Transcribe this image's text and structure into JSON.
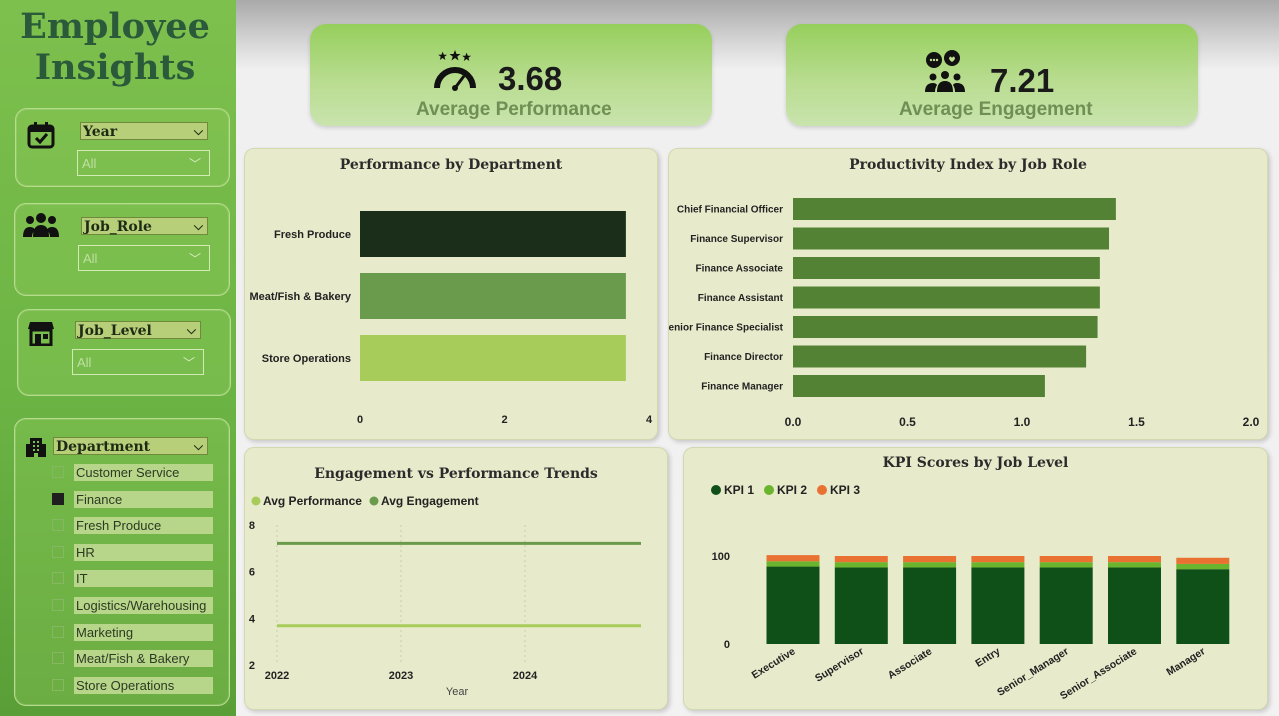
{
  "sidebar": {
    "title_line1": "Employee",
    "title_line2": "Insights",
    "slicers": {
      "year": {
        "label": "Year",
        "value": "All",
        "icon": "calendar-icon"
      },
      "job_role": {
        "label": "Job_Role",
        "value": "All",
        "icon": "people-group-icon"
      },
      "job_level": {
        "label": "Job_Level",
        "value": "All",
        "icon": "store-icon"
      }
    },
    "department": {
      "label": "Department",
      "icon": "building-icon",
      "items": [
        {
          "label": "Customer Service",
          "checked": false
        },
        {
          "label": "Finance",
          "checked": true
        },
        {
          "label": "Fresh Produce",
          "checked": false
        },
        {
          "label": "HR",
          "checked": false
        },
        {
          "label": "IT",
          "checked": false
        },
        {
          "label": "Logistics/Warehousing",
          "checked": false
        },
        {
          "label": "Marketing",
          "checked": false
        },
        {
          "label": "Meat/Fish & Bakery",
          "checked": false
        },
        {
          "label": "Store Operations",
          "checked": false
        }
      ]
    }
  },
  "kpis": {
    "performance": {
      "value": "3.68",
      "label": "Average Performance",
      "icon": "speedometer-stars-icon"
    },
    "engagement": {
      "value": "7.21",
      "label": "Average Engagement",
      "icon": "team-chat-icon"
    }
  },
  "charts": {
    "performance_by_department": {
      "title": "Performance by Department",
      "chart_data": {
        "type": "bar",
        "orientation": "horizontal",
        "categories": [
          "Fresh Produce",
          "Meat/Fish & Bakery",
          "Store Operations"
        ],
        "values": [
          3.68,
          3.68,
          3.68
        ],
        "colors": [
          "#1a2e1a",
          "#6a9a4c",
          "#a8cc5a"
        ],
        "xlim": [
          0,
          4
        ],
        "xticks": [
          "0",
          "2",
          "4"
        ]
      }
    },
    "productivity_by_role": {
      "title": "Productivity Index by Job Role",
      "chart_data": {
        "type": "bar",
        "orientation": "horizontal",
        "categories": [
          "Chief Financial Officer",
          "Finance Supervisor",
          "Finance Associate",
          "Finance Assistant",
          "Senior Finance Specialist",
          "Finance Director",
          "Finance Manager"
        ],
        "values": [
          1.41,
          1.38,
          1.34,
          1.34,
          1.33,
          1.28,
          1.1
        ],
        "color": "#548235",
        "xlim": [
          0,
          2.0
        ],
        "xticks": [
          "0.0",
          "0.5",
          "1.0",
          "1.5",
          "2.0"
        ]
      }
    },
    "engagement_vs_performance": {
      "title": "Engagement vs Performance Trends",
      "chart_data": {
        "type": "line",
        "x": [
          "2022",
          "2023",
          "2024"
        ],
        "xlabel": "Year",
        "series": [
          {
            "name": "Avg Performance",
            "values": [
              3.68,
              3.68,
              3.68
            ],
            "color": "#a8cc5a"
          },
          {
            "name": "Avg Engagement",
            "values": [
              7.21,
              7.21,
              7.21
            ],
            "color": "#6a9a4c"
          }
        ],
        "ylim": [
          2,
          8
        ],
        "yticks": [
          "2",
          "4",
          "6",
          "8"
        ]
      }
    },
    "kpi_by_level": {
      "title": "KPI Scores by Job Level",
      "chart_data": {
        "type": "bar",
        "stacked": true,
        "categories": [
          "Executive",
          "Supervisor",
          "Associate",
          "Entry",
          "Senior_Manager",
          "Senior_Associate",
          "Manager"
        ],
        "series": [
          {
            "name": "KPI 1",
            "values": [
              88,
              87,
              87,
              87,
              87,
              87,
              85
            ],
            "color": "#0f4f18"
          },
          {
            "name": "KPI 2",
            "values": [
              6,
              6,
              6,
              6,
              6,
              6,
              6
            ],
            "color": "#6ab42e"
          },
          {
            "name": "KPI 3",
            "values": [
              7,
              7,
              7,
              7,
              7,
              7,
              7
            ],
            "color": "#e97132"
          }
        ],
        "ylim": [
          0,
          110
        ],
        "yticks": [
          "0",
          "100"
        ]
      }
    }
  }
}
